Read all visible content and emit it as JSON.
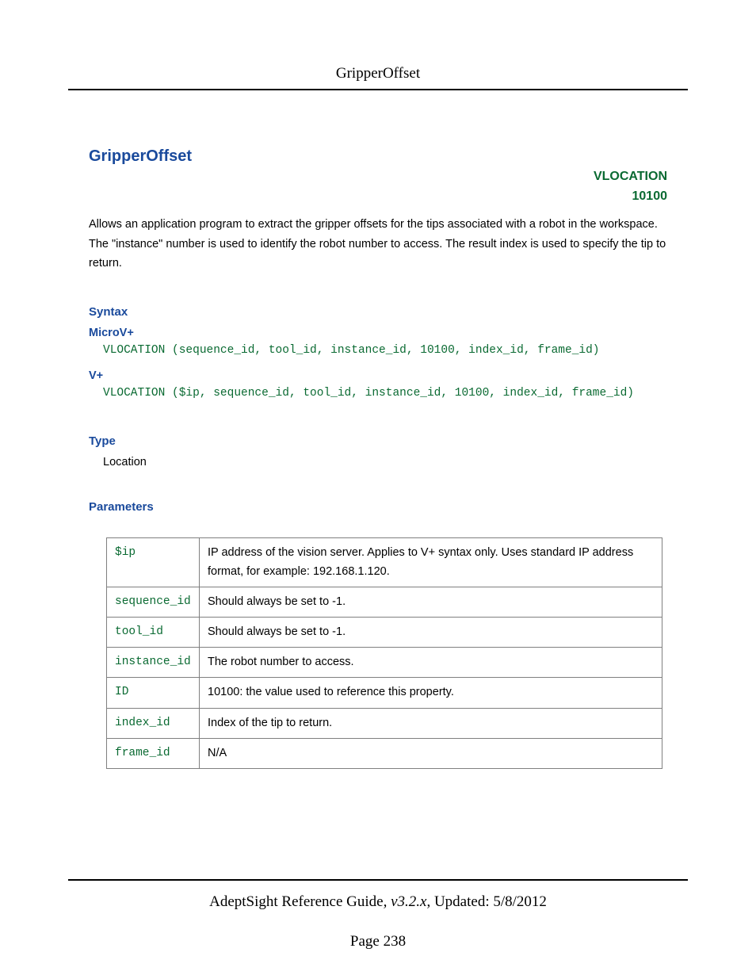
{
  "header": {
    "title": "GripperOffset"
  },
  "main": {
    "title": "GripperOffset",
    "tag_line1": "VLOCATION",
    "tag_line2": "10100",
    "description": "Allows an application program to extract the gripper offsets for the tips associated with a robot in the workspace. The \"instance\" number is used to identify the robot number to access. The result index is used to specify the tip to return.",
    "syntax_heading": "Syntax",
    "microv_label": "MicroV+",
    "microv_code": "VLOCATION (sequence_id, tool_id, instance_id, 10100, index_id, frame_id)",
    "vplus_label": "V+",
    "vplus_code": "VLOCATION ($ip, sequence_id, tool_id, instance_id, 10100, index_id, frame_id)",
    "type_heading": "Type",
    "type_value": "Location",
    "params_heading": "Parameters",
    "params": [
      {
        "name": "$ip",
        "desc": "IP address of the vision server. Applies to V+ syntax only. Uses standard IP address format, for example: 192.168.1.120."
      },
      {
        "name": "sequence_id",
        "desc": "Should always be set to -1."
      },
      {
        "name": "tool_id",
        "desc": "Should always be set to -1."
      },
      {
        "name": "instance_id",
        "desc": "The robot number to access."
      },
      {
        "name": "ID",
        "desc": "10100: the value used to reference this property."
      },
      {
        "name": "index_id",
        "desc": "Index of the tip to return."
      },
      {
        "name": "frame_id",
        "desc": "N/A"
      }
    ]
  },
  "footer": {
    "guide": "AdeptSight Reference Guide",
    "version": ", v3.2.x",
    "updated": ", Updated: 5/8/2012",
    "page": "Page 238"
  }
}
